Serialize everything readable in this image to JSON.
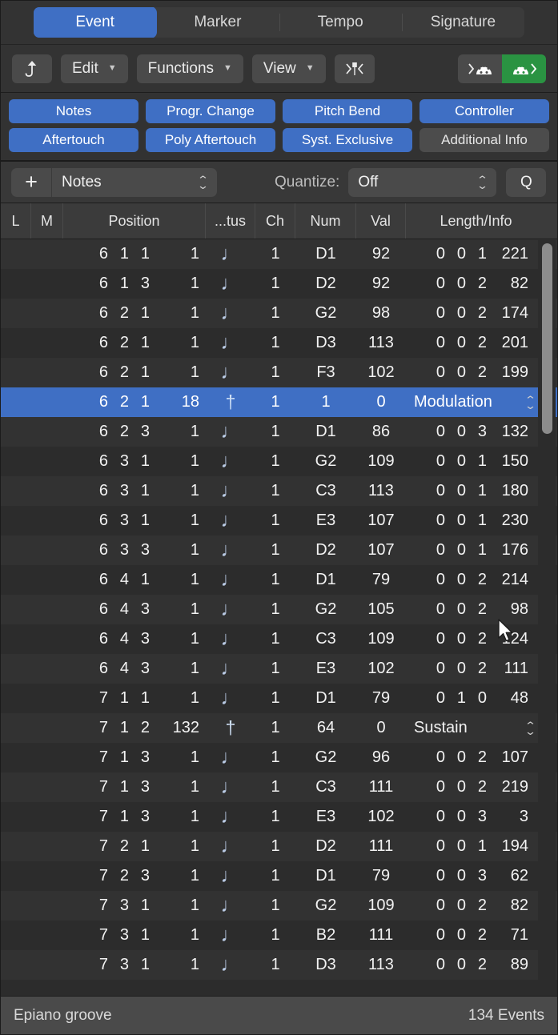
{
  "tabs": {
    "items": [
      {
        "label": "Event",
        "active": true
      },
      {
        "label": "Marker",
        "active": false
      },
      {
        "label": "Tempo",
        "active": false
      },
      {
        "label": "Signature",
        "active": false
      }
    ]
  },
  "toolbar": {
    "up_icon": "arrow-up-icon",
    "edit_label": "Edit",
    "functions_label": "Functions",
    "view_label": "View",
    "catch_icon": "catch-playhead-icon",
    "midi_in_icon": "midi-in-icon",
    "midi_out_icon": "midi-out-icon",
    "active_color": "#2a9342"
  },
  "filters": {
    "accent_on": "#3f6fc4",
    "accent_off": "#4c4c4c",
    "row1": [
      {
        "label": "Notes",
        "on": true
      },
      {
        "label": "Progr. Change",
        "on": true
      },
      {
        "label": "Pitch Bend",
        "on": true
      },
      {
        "label": "Controller",
        "on": true
      }
    ],
    "row2": [
      {
        "label": "Aftertouch",
        "on": true
      },
      {
        "label": "Poly Aftertouch",
        "on": true
      },
      {
        "label": "Syst. Exclusive",
        "on": true
      },
      {
        "label": "Additional Info",
        "on": false
      }
    ]
  },
  "subbar": {
    "add_label": "+",
    "type_value": "Notes",
    "quantize_label": "Quantize:",
    "quantize_value": "Off",
    "q_label": "Q"
  },
  "table": {
    "headers": {
      "lock": "L",
      "mute": "M",
      "position": "Position",
      "status": "...tus",
      "channel": "Ch",
      "num": "Num",
      "val": "Val",
      "length": "Length/Info"
    },
    "rows": [
      {
        "bar": "6",
        "beat": "1",
        "div": "1",
        "tick": "1",
        "status": "note",
        "ch": "1",
        "num": "D1",
        "val": "92",
        "len": [
          "0",
          "0",
          "1",
          "221"
        ],
        "info": null,
        "selected": false
      },
      {
        "bar": "6",
        "beat": "1",
        "div": "3",
        "tick": "1",
        "status": "note",
        "ch": "1",
        "num": "D2",
        "val": "92",
        "len": [
          "0",
          "0",
          "2",
          "82"
        ],
        "info": null,
        "selected": false
      },
      {
        "bar": "6",
        "beat": "2",
        "div": "1",
        "tick": "1",
        "status": "note",
        "ch": "1",
        "num": "G2",
        "val": "98",
        "len": [
          "0",
          "0",
          "2",
          "174"
        ],
        "info": null,
        "selected": false
      },
      {
        "bar": "6",
        "beat": "2",
        "div": "1",
        "tick": "1",
        "status": "note",
        "ch": "1",
        "num": "D3",
        "val": "113",
        "len": [
          "0",
          "0",
          "2",
          "201"
        ],
        "info": null,
        "selected": false
      },
      {
        "bar": "6",
        "beat": "2",
        "div": "1",
        "tick": "1",
        "status": "note",
        "ch": "1",
        "num": "F3",
        "val": "102",
        "len": [
          "0",
          "0",
          "2",
          "199"
        ],
        "info": null,
        "selected": false
      },
      {
        "bar": "6",
        "beat": "2",
        "div": "1",
        "tick": "18",
        "status": "ctrl",
        "ch": "1",
        "num": "1",
        "val": "0",
        "len": null,
        "info": "Modulation",
        "selected": true
      },
      {
        "bar": "6",
        "beat": "2",
        "div": "3",
        "tick": "1",
        "status": "note",
        "ch": "1",
        "num": "D1",
        "val": "86",
        "len": [
          "0",
          "0",
          "3",
          "132"
        ],
        "info": null,
        "selected": false
      },
      {
        "bar": "6",
        "beat": "3",
        "div": "1",
        "tick": "1",
        "status": "note",
        "ch": "1",
        "num": "G2",
        "val": "109",
        "len": [
          "0",
          "0",
          "1",
          "150"
        ],
        "info": null,
        "selected": false
      },
      {
        "bar": "6",
        "beat": "3",
        "div": "1",
        "tick": "1",
        "status": "note",
        "ch": "1",
        "num": "C3",
        "val": "113",
        "len": [
          "0",
          "0",
          "1",
          "180"
        ],
        "info": null,
        "selected": false
      },
      {
        "bar": "6",
        "beat": "3",
        "div": "1",
        "tick": "1",
        "status": "note",
        "ch": "1",
        "num": "E3",
        "val": "107",
        "len": [
          "0",
          "0",
          "1",
          "230"
        ],
        "info": null,
        "selected": false
      },
      {
        "bar": "6",
        "beat": "3",
        "div": "3",
        "tick": "1",
        "status": "note",
        "ch": "1",
        "num": "D2",
        "val": "107",
        "len": [
          "0",
          "0",
          "1",
          "176"
        ],
        "info": null,
        "selected": false
      },
      {
        "bar": "6",
        "beat": "4",
        "div": "1",
        "tick": "1",
        "status": "note",
        "ch": "1",
        "num": "D1",
        "val": "79",
        "len": [
          "0",
          "0",
          "2",
          "214"
        ],
        "info": null,
        "selected": false
      },
      {
        "bar": "6",
        "beat": "4",
        "div": "3",
        "tick": "1",
        "status": "note",
        "ch": "1",
        "num": "G2",
        "val": "105",
        "len": [
          "0",
          "0",
          "2",
          "98"
        ],
        "info": null,
        "selected": false
      },
      {
        "bar": "6",
        "beat": "4",
        "div": "3",
        "tick": "1",
        "status": "note",
        "ch": "1",
        "num": "C3",
        "val": "109",
        "len": [
          "0",
          "0",
          "2",
          "124"
        ],
        "info": null,
        "selected": false
      },
      {
        "bar": "6",
        "beat": "4",
        "div": "3",
        "tick": "1",
        "status": "note",
        "ch": "1",
        "num": "E3",
        "val": "102",
        "len": [
          "0",
          "0",
          "2",
          "111"
        ],
        "info": null,
        "selected": false
      },
      {
        "bar": "7",
        "beat": "1",
        "div": "1",
        "tick": "1",
        "status": "note",
        "ch": "1",
        "num": "D1",
        "val": "79",
        "len": [
          "0",
          "1",
          "0",
          "48"
        ],
        "info": null,
        "selected": false
      },
      {
        "bar": "7",
        "beat": "1",
        "div": "2",
        "tick": "132",
        "status": "ctrl",
        "ch": "1",
        "num": "64",
        "val": "0",
        "len": null,
        "info": "Sustain",
        "selected": false
      },
      {
        "bar": "7",
        "beat": "1",
        "div": "3",
        "tick": "1",
        "status": "note",
        "ch": "1",
        "num": "G2",
        "val": "96",
        "len": [
          "0",
          "0",
          "2",
          "107"
        ],
        "info": null,
        "selected": false
      },
      {
        "bar": "7",
        "beat": "1",
        "div": "3",
        "tick": "1",
        "status": "note",
        "ch": "1",
        "num": "C3",
        "val": "111",
        "len": [
          "0",
          "0",
          "2",
          "219"
        ],
        "info": null,
        "selected": false
      },
      {
        "bar": "7",
        "beat": "1",
        "div": "3",
        "tick": "1",
        "status": "note",
        "ch": "1",
        "num": "E3",
        "val": "102",
        "len": [
          "0",
          "0",
          "3",
          "3"
        ],
        "info": null,
        "selected": false
      },
      {
        "bar": "7",
        "beat": "2",
        "div": "1",
        "tick": "1",
        "status": "note",
        "ch": "1",
        "num": "D2",
        "val": "111",
        "len": [
          "0",
          "0",
          "1",
          "194"
        ],
        "info": null,
        "selected": false
      },
      {
        "bar": "7",
        "beat": "2",
        "div": "3",
        "tick": "1",
        "status": "note",
        "ch": "1",
        "num": "D1",
        "val": "79",
        "len": [
          "0",
          "0",
          "3",
          "62"
        ],
        "info": null,
        "selected": false
      },
      {
        "bar": "7",
        "beat": "3",
        "div": "1",
        "tick": "1",
        "status": "note",
        "ch": "1",
        "num": "G2",
        "val": "109",
        "len": [
          "0",
          "0",
          "2",
          "82"
        ],
        "info": null,
        "selected": false
      },
      {
        "bar": "7",
        "beat": "3",
        "div": "1",
        "tick": "1",
        "status": "note",
        "ch": "1",
        "num": "B2",
        "val": "111",
        "len": [
          "0",
          "0",
          "2",
          "71"
        ],
        "info": null,
        "selected": false
      },
      {
        "bar": "7",
        "beat": "3",
        "div": "1",
        "tick": "1",
        "status": "note",
        "ch": "1",
        "num": "D3",
        "val": "113",
        "len": [
          "0",
          "0",
          "2",
          "89"
        ],
        "info": null,
        "selected": false
      }
    ]
  },
  "footer": {
    "region_name": "Epiano groove",
    "event_count": "134 Events"
  }
}
